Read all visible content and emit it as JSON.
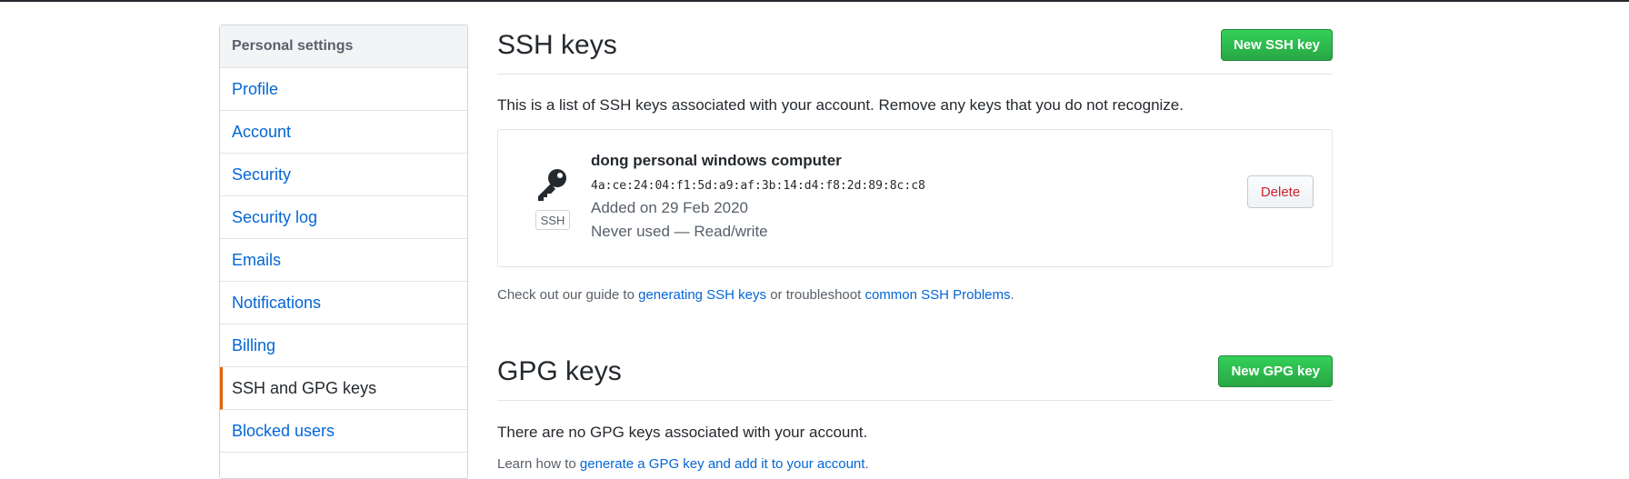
{
  "sidebar": {
    "header": "Personal settings",
    "items": [
      {
        "label": "Profile"
      },
      {
        "label": "Account"
      },
      {
        "label": "Security"
      },
      {
        "label": "Security log"
      },
      {
        "label": "Emails"
      },
      {
        "label": "Notifications"
      },
      {
        "label": "Billing"
      },
      {
        "label": "SSH and GPG keys",
        "selected": true
      },
      {
        "label": "Blocked users"
      }
    ]
  },
  "ssh": {
    "title": "SSH keys",
    "new_button": "New SSH key",
    "description": "This is a list of SSH keys associated with your account. Remove any keys that you do not recognize.",
    "keys": [
      {
        "badge": "SSH",
        "title": "dong personal windows computer",
        "fingerprint": "4a:ce:24:04:f1:5d:a9:af:3b:14:d4:f8:2d:89:8c:c8",
        "added": "Added on 29 Feb 2020",
        "usage": "Never used — Read/write",
        "delete_label": "Delete",
        "icon": "key-icon"
      }
    ],
    "guide": {
      "prefix": "Check out our guide to ",
      "link1": "generating SSH keys",
      "middle": " or troubleshoot ",
      "link2": "common SSH Problems",
      "suffix": "."
    }
  },
  "gpg": {
    "title": "GPG keys",
    "new_button": "New GPG key",
    "empty_text": "There are no GPG keys associated with your account.",
    "learn": {
      "prefix": "Learn how to ",
      "link": "generate a GPG key and add it to your account",
      "suffix": "."
    }
  },
  "colors": {
    "link": "#0366d6",
    "green": "#28a745",
    "danger": "#cb2431",
    "selected_accent": "#e36209"
  }
}
